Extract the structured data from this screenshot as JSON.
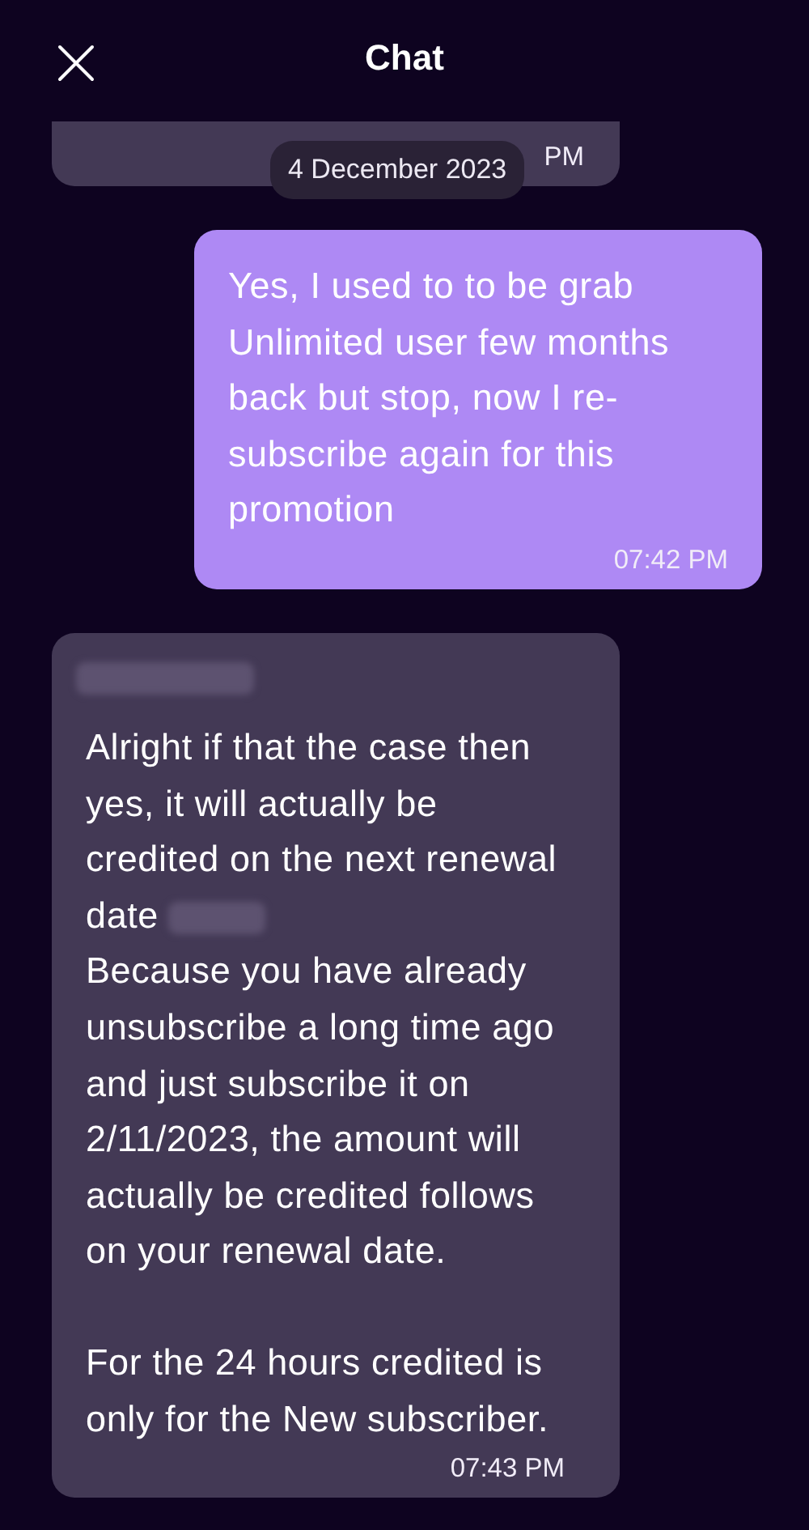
{
  "header": {
    "title": "Chat"
  },
  "date_separator": "4 December 2023",
  "messages": [
    {
      "kind": "partial",
      "time": "PM"
    },
    {
      "kind": "sent",
      "paragraphs": [
        {
          "text": "Yes, I used to to be grab Unlimited user few months back but stop, now I re-subscribe again for this promotion",
          "redacted_tail": false
        }
      ],
      "time": "07:42 PM",
      "redacted_sender": false
    },
    {
      "kind": "received",
      "redacted_sender": true,
      "paragraphs": [
        {
          "text": "Alright if that the case then yes, it will actually be credited on the next renewal date",
          "redacted_tail": true
        },
        {
          "text": "Because you have already unsubscribe a long time ago and just subscribe it on 2/11/2023, the amount will actually be credited follows on your renewal date.",
          "redacted_tail": false
        },
        {
          "text": "For the 24 hours credited is only for the New subscriber.",
          "redacted_tail": false,
          "gap_before": true
        }
      ],
      "time": "07:43 PM"
    }
  ]
}
